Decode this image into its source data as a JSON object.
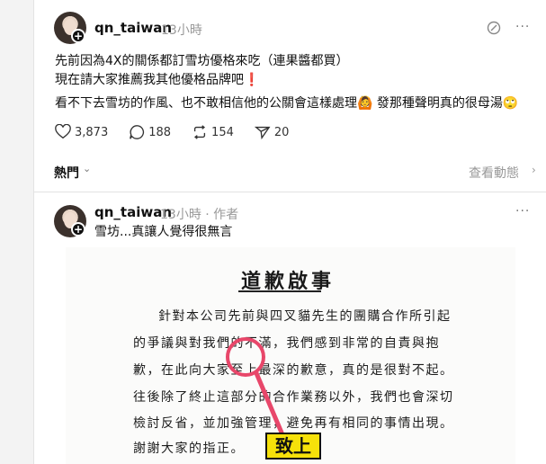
{
  "post1": {
    "username": "qn_taiwan",
    "time": "13小時",
    "line1": "先前因為4X的關係都訂雪坊優格來吃（連果醬都買）",
    "line2": "現在請大家推薦我其他優格品牌吧❗",
    "line3": "看不下去雪坊的作風、也不敢相信他的公關會這樣處理🙆 發那種聲明真的很母湯🙄",
    "stats": {
      "likes": "3,873",
      "comments": "188",
      "reposts": "154",
      "shares": "20"
    },
    "more": "···"
  },
  "sort": {
    "label": "熱門",
    "view_activity": "查看動態"
  },
  "post2": {
    "username": "qn_taiwan",
    "time": "13小時 · 作者",
    "text": "雪坊...真讓人覺得很無言",
    "more": "···"
  },
  "image": {
    "title": "道歉啟事",
    "lines": [
      "針對本公司先前與四叉貓先生的團購合作所引起",
      "的爭議與對我們的不滿，我們感到非常的自責與抱",
      "歉，在此向大家至上最深的歉意，真的是很對不起。",
      "往後除了終止這部分的合作業務以外，我們也會深切",
      "檢討反省，並加強管理，避免再有相同的事情出現。",
      "謝謝大家的指正。"
    ],
    "badge": "致上",
    "annotation_color": "#e8476a"
  }
}
